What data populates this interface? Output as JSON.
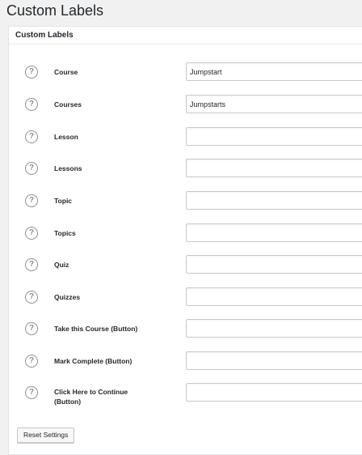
{
  "page": {
    "title": "Custom Labels"
  },
  "panel": {
    "title": "Custom Labels"
  },
  "help_icon": "?",
  "fields": [
    {
      "label": "Course",
      "value": "Jumpstart"
    },
    {
      "label": "Courses",
      "value": "Jumpstarts"
    },
    {
      "label": "Lesson",
      "value": ""
    },
    {
      "label": "Lessons",
      "value": ""
    },
    {
      "label": "Topic",
      "value": ""
    },
    {
      "label": "Topics",
      "value": ""
    },
    {
      "label": "Quiz",
      "value": ""
    },
    {
      "label": "Quizzes",
      "value": ""
    },
    {
      "label": "Take this Course (Button)",
      "value": ""
    },
    {
      "label": "Mark Complete (Button)",
      "value": ""
    },
    {
      "label": "Click Here to Continue (Button)",
      "value": ""
    }
  ],
  "buttons": {
    "reset": "Reset Settings"
  }
}
